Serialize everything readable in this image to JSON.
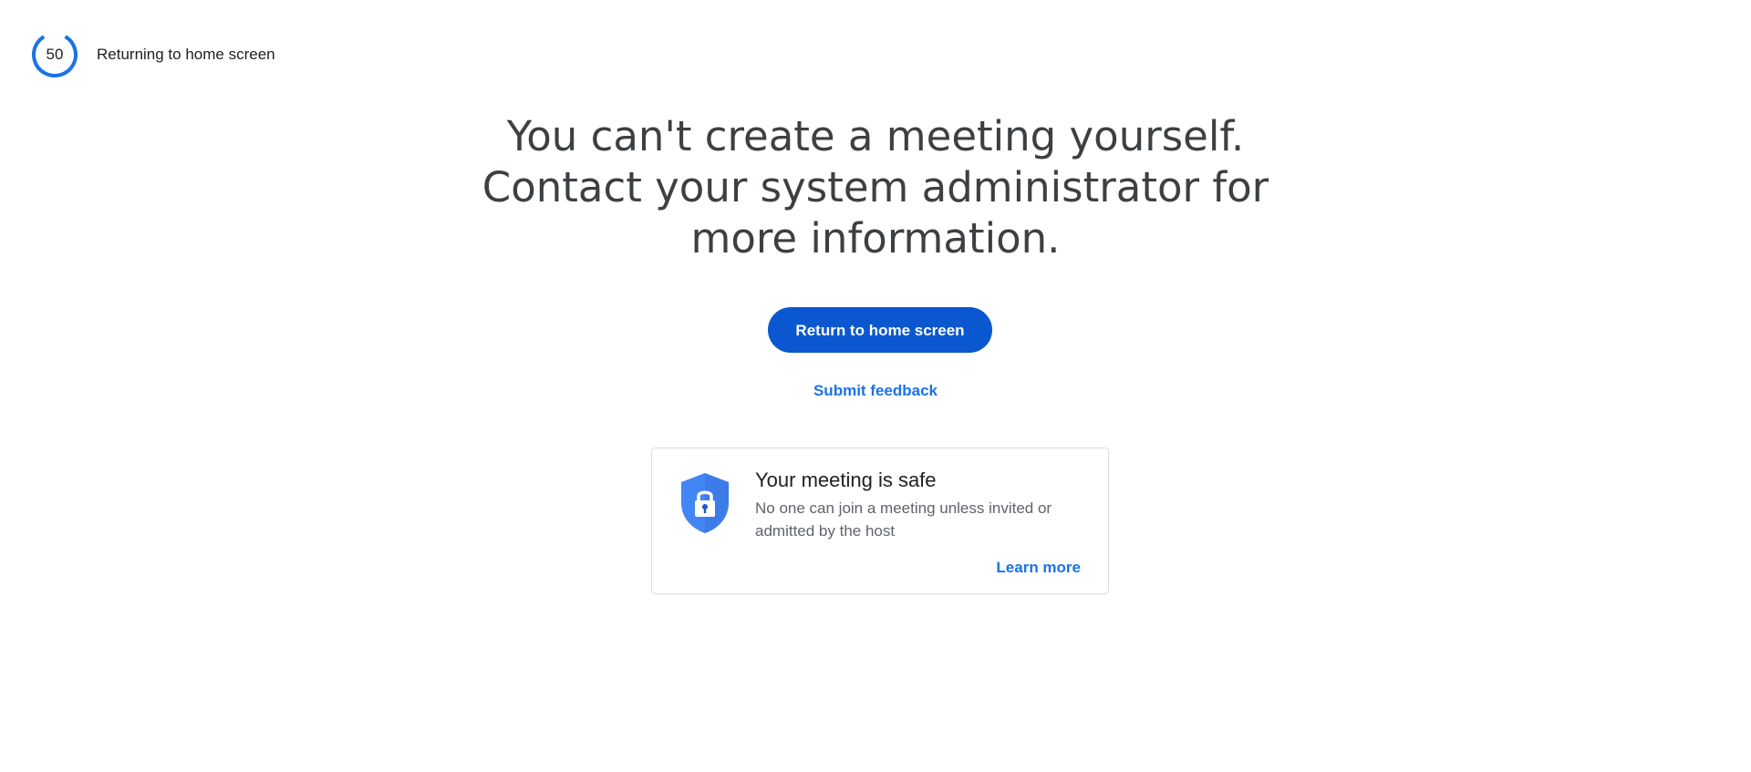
{
  "countdown": {
    "value": "50",
    "label": "Returning to home screen",
    "progress": 0.83,
    "accent_color": "#1a73e8"
  },
  "message": {
    "line1": "You can't create a meeting yourself.",
    "line2": "Contact your system administrator for",
    "line3": "more information."
  },
  "actions": {
    "return_label": "Return to home screen",
    "return_color": "#0b57d0",
    "feedback_label": "Submit feedback"
  },
  "safety_card": {
    "icon": "shield-lock-icon",
    "title": "Your meeting is safe",
    "body": "No one can join a meeting unless invited or admitted by the host",
    "link_label": "Learn more"
  }
}
